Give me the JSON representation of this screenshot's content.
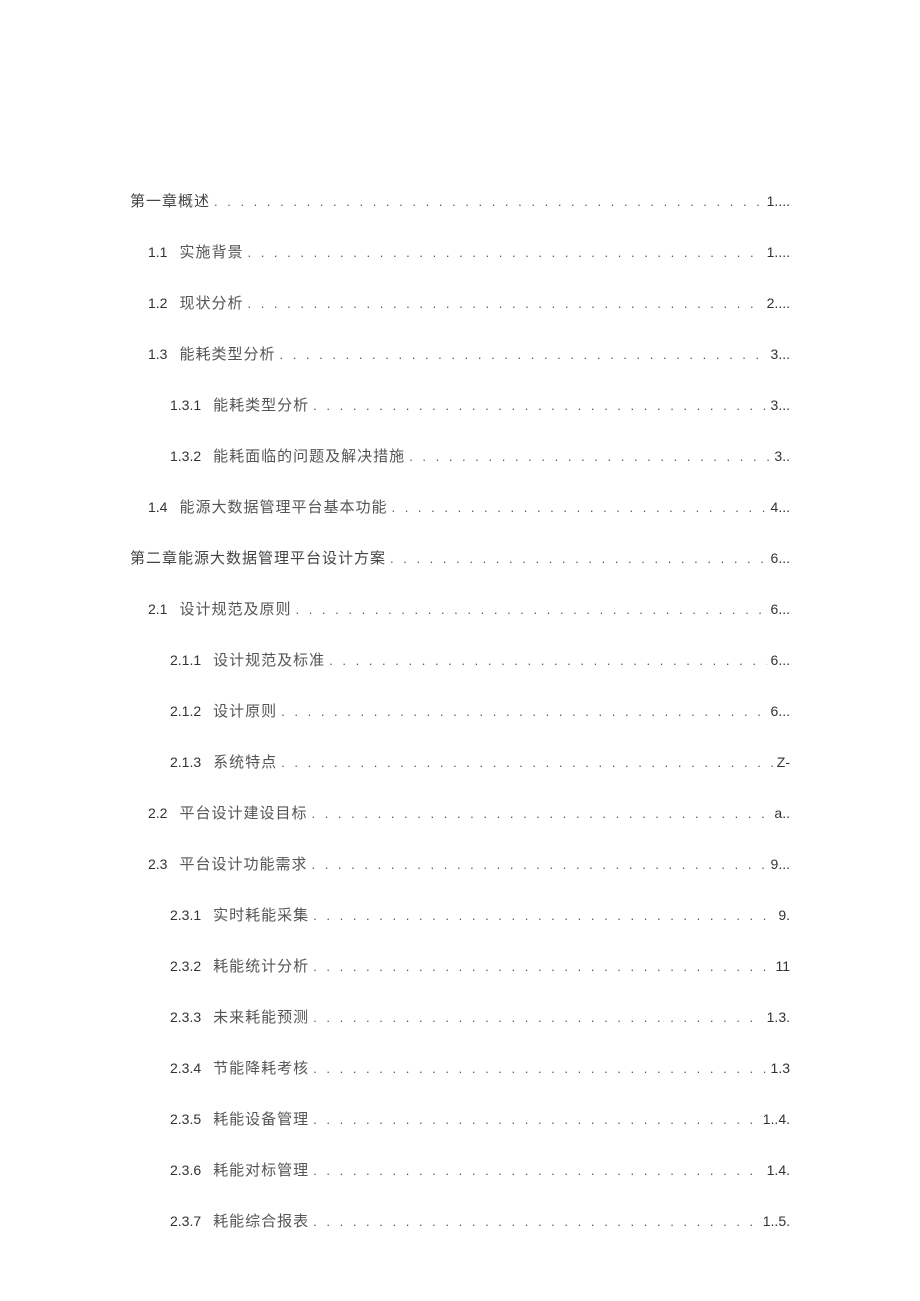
{
  "toc": [
    {
      "indent": 0,
      "num": "",
      "title": "第一章概述",
      "page": "1...."
    },
    {
      "indent": 1,
      "num": "1.1",
      "title": "实施背景",
      "page": "1...."
    },
    {
      "indent": 1,
      "num": "1.2",
      "title": "现状分析",
      "page": "2...."
    },
    {
      "indent": 1,
      "num": "1.3",
      "title": "能耗类型分析",
      "page": "3..."
    },
    {
      "indent": 2,
      "num": "1.3.1",
      "title": "能耗类型分析",
      "page": "3..."
    },
    {
      "indent": 2,
      "num": "1.3.2",
      "title": "能耗面临的问题及解决措施",
      "page": "3.."
    },
    {
      "indent": 1,
      "num": "1.4",
      "title": "能源大数据管理平台基本功能",
      "page": "4..."
    },
    {
      "indent": 0,
      "num": "",
      "title": "第二章能源大数据管理平台设计方案",
      "page": "6..."
    },
    {
      "indent": 1,
      "num": "2.1",
      "title": "设计规范及原则",
      "page": "6..."
    },
    {
      "indent": 2,
      "num": "2.1.1",
      "title": "设计规范及标准",
      "page": "6..."
    },
    {
      "indent": 2,
      "num": "2.1.2",
      "title": "设计原则",
      "page": "6..."
    },
    {
      "indent": 2,
      "num": "2.1.3",
      "title": "系统特点",
      "page": "Z-"
    },
    {
      "indent": 1,
      "num": "2.2",
      "title": "平台设计建设目标",
      "page": "a.."
    },
    {
      "indent": 1,
      "num": "2.3",
      "title": "平台设计功能需求",
      "page": "9..."
    },
    {
      "indent": 2,
      "num": "2.3.1",
      "title": "实时耗能采集",
      "page": "9."
    },
    {
      "indent": 2,
      "num": "2.3.2",
      "title": "耗能统计分析",
      "page": "11"
    },
    {
      "indent": 2,
      "num": "2.3.3",
      "title": "未来耗能预测",
      "page": "1.3."
    },
    {
      "indent": 2,
      "num": "2.3.4",
      "title": "节能降耗考核",
      "page": "1.3"
    },
    {
      "indent": 2,
      "num": "2.3.5",
      "title": "耗能设备管理",
      "page": "1..4."
    },
    {
      "indent": 2,
      "num": "2.3.6",
      "title": "耗能对标管理",
      "page": "1.4."
    },
    {
      "indent": 2,
      "num": "2.3.7",
      "title": "耗能综合报表",
      "page": "1..5."
    }
  ]
}
